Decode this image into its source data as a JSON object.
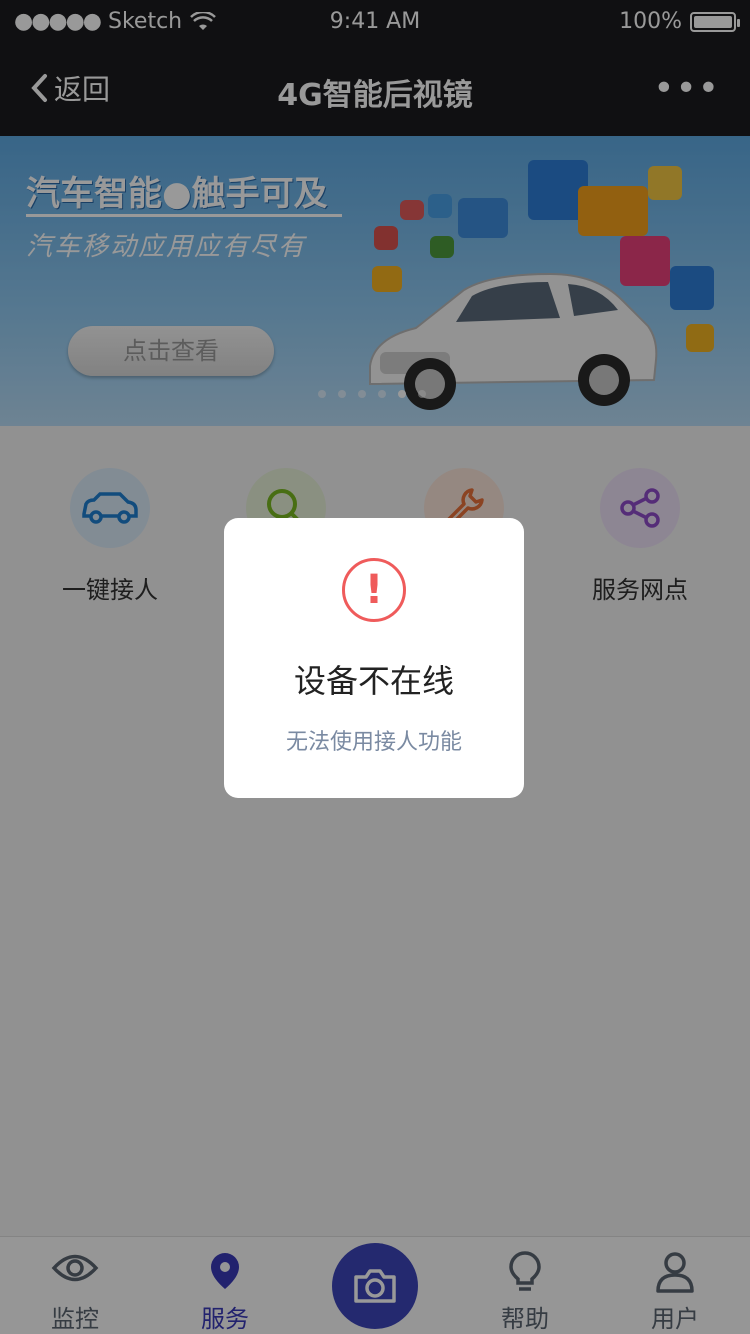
{
  "status_bar": {
    "signal": "●●●●●",
    "carrier": "Sketch",
    "time": "9:41 AM",
    "battery": "100%",
    "battery_level": 1.0
  },
  "nav": {
    "back_label": "返回",
    "title": "4G智能后视镜",
    "more": "•••"
  },
  "banner": {
    "slogan": "汽车智能●触手可及",
    "subslogan": "汽车移动应用应有尽有",
    "view_button": "点击查看",
    "pages": 6,
    "active_page": 4
  },
  "services": [
    {
      "label": "一键接人",
      "icon": "car-icon",
      "color": "#1f7fd0"
    },
    {
      "label": "",
      "icon": "search-icon",
      "color": "#79b821"
    },
    {
      "label": "",
      "icon": "wrench-icon",
      "color": "#e8713a"
    },
    {
      "label": "服务网点",
      "icon": "share-icon",
      "color": "#8e4bc9"
    }
  ],
  "tabbar": {
    "tabs": [
      {
        "label": "监控",
        "icon": "eye-icon"
      },
      {
        "label": "服务",
        "icon": "location-pin-icon",
        "active": true
      },
      {
        "label": "",
        "icon": "camera-icon"
      },
      {
        "label": "帮助",
        "icon": "lightbulb-icon"
      },
      {
        "label": "用户",
        "icon": "user-icon"
      }
    ]
  },
  "modal": {
    "icon": "alert-icon",
    "icon_glyph": "!",
    "title": "设备不在线",
    "message": "无法使用接人功能",
    "accent_color": "#ef5b5b"
  }
}
